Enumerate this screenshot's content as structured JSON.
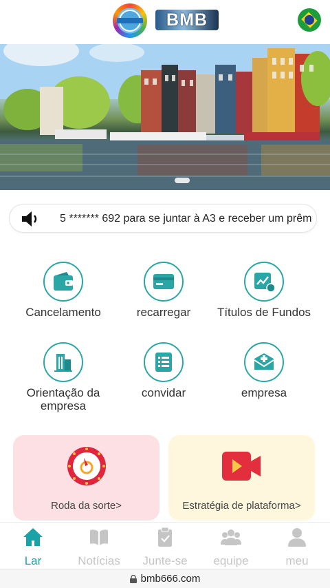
{
  "header": {
    "logo_text": "BMB"
  },
  "notice": {
    "text": "5 ******* 692 para se juntar à A3 e receber um prêm"
  },
  "grid": [
    {
      "label": "Cancelamento",
      "icon": "wallet-icon"
    },
    {
      "label": "recarregar",
      "icon": "card-icon"
    },
    {
      "label": "Títulos de Fundos",
      "icon": "fund-chart-icon"
    },
    {
      "label": "Orientação da empresa",
      "icon": "building-icon"
    },
    {
      "label": "convidar",
      "icon": "list-icon"
    },
    {
      "label": "empresa",
      "icon": "mail-icon"
    }
  ],
  "cards": [
    {
      "label": "Roda da sorte>",
      "icon": "wheel-icon",
      "bg": "#fde0e3"
    },
    {
      "label": "Estratégia de plataforma>",
      "icon": "video-icon",
      "bg": "#fff7dd"
    }
  ],
  "tabs": [
    {
      "label": "Lar",
      "icon": "home-icon",
      "active": true
    },
    {
      "label": "Notícias",
      "icon": "news-icon",
      "active": false
    },
    {
      "label": "Junte-se",
      "icon": "clipboard-icon",
      "active": false
    },
    {
      "label": "equipe",
      "icon": "team-icon",
      "active": false
    },
    {
      "label": "meu",
      "icon": "user-icon",
      "active": false
    }
  ],
  "browser": {
    "url": "bmb666.com"
  },
  "colors": {
    "accent": "#1aa2a8",
    "teal_icon": "#2aa6a6",
    "inactive": "#c5c5c5"
  }
}
